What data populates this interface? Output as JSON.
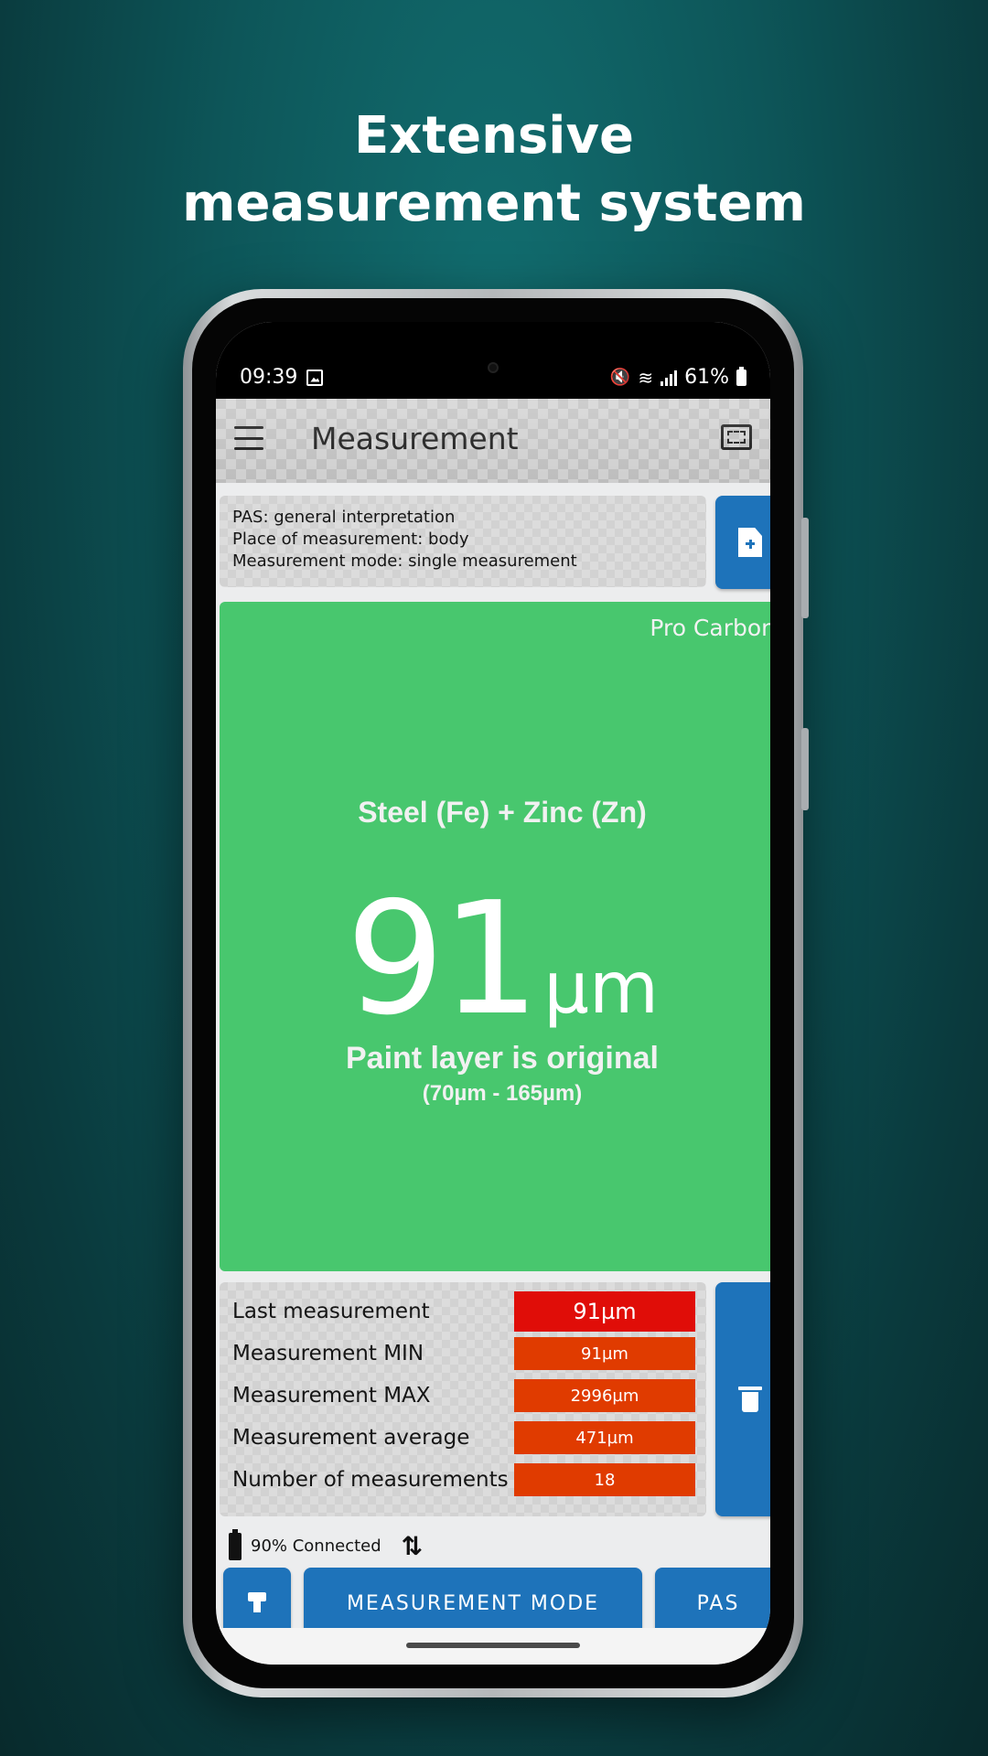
{
  "headline": {
    "line1": "Extensive",
    "line2": "measurement system"
  },
  "status_bar": {
    "time": "09:39",
    "battery": "61%"
  },
  "app_bar": {
    "title": "Measurement"
  },
  "info": {
    "pas": "PAS: general interpretation",
    "place": "Place of measurement: body",
    "mode": "Measurement mode: single measurement"
  },
  "result": {
    "profile": "Pro Carbon",
    "material": "Steel (Fe) + Zinc (Zn)",
    "value": "91",
    "unit": "µm",
    "verdict": "Paint layer is original",
    "range": "(70µm - 165µm)",
    "color": "#48c76e"
  },
  "stats": [
    {
      "label": "Last measurement",
      "value": "91µm"
    },
    {
      "label": "Measurement MIN",
      "value": "91µm"
    },
    {
      "label": "Measurement MAX",
      "value": "2996µm"
    },
    {
      "label": "Measurement average",
      "value": "471µm"
    },
    {
      "label": "Number of measurements",
      "value": "18"
    }
  ],
  "connection": {
    "text": "90% Connected"
  },
  "bottom_bar": {
    "mode_label": "MEASUREMENT MODE",
    "pas_label": "PAS"
  },
  "icons": {
    "menu": "menu-icon",
    "fullscreen": "fullscreen-icon",
    "new_document": "file-plus-icon",
    "delete": "trash-icon",
    "battery": "battery-icon",
    "sync": "sync-arrows-icon",
    "probe": "probe-icon"
  },
  "colors": {
    "accent": "#1e73ba",
    "ok": "#48c76e",
    "warning": "#e03b00",
    "alert": "#e00d08"
  }
}
